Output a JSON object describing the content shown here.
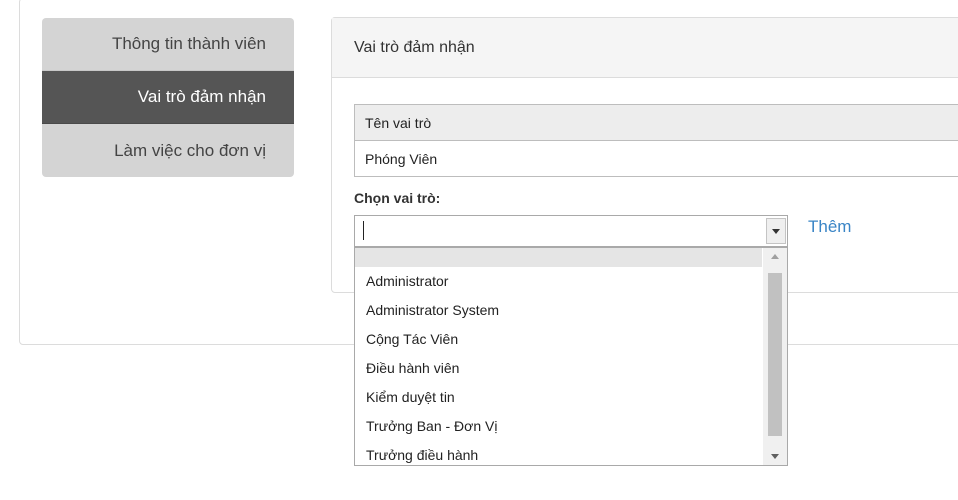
{
  "tabs": [
    {
      "label": "Thông tin thành viên",
      "active": false
    },
    {
      "label": "Vai trò đảm nhận",
      "active": true
    },
    {
      "label": "Làm việc cho đơn vị",
      "active": false
    }
  ],
  "panel": {
    "heading": "Vai trò đảm nhận",
    "table": {
      "header": "Tên vai trò",
      "rows": [
        "Phóng Viên"
      ]
    },
    "choose_label": "Chọn vai trò:",
    "combo_value": "",
    "add_label": "Thêm",
    "dropdown_options": [
      "",
      "Administrator",
      "Administrator System",
      "Cộng Tác Viên",
      "Điều hành viên",
      "Kiểm duyệt tin",
      "Trưởng Ban - Đơn Vị",
      "Trưởng điều hành"
    ]
  },
  "colors": {
    "active_tab": "#555555",
    "inactive_tab": "#d4d4d4",
    "link": "#3a85c6"
  }
}
